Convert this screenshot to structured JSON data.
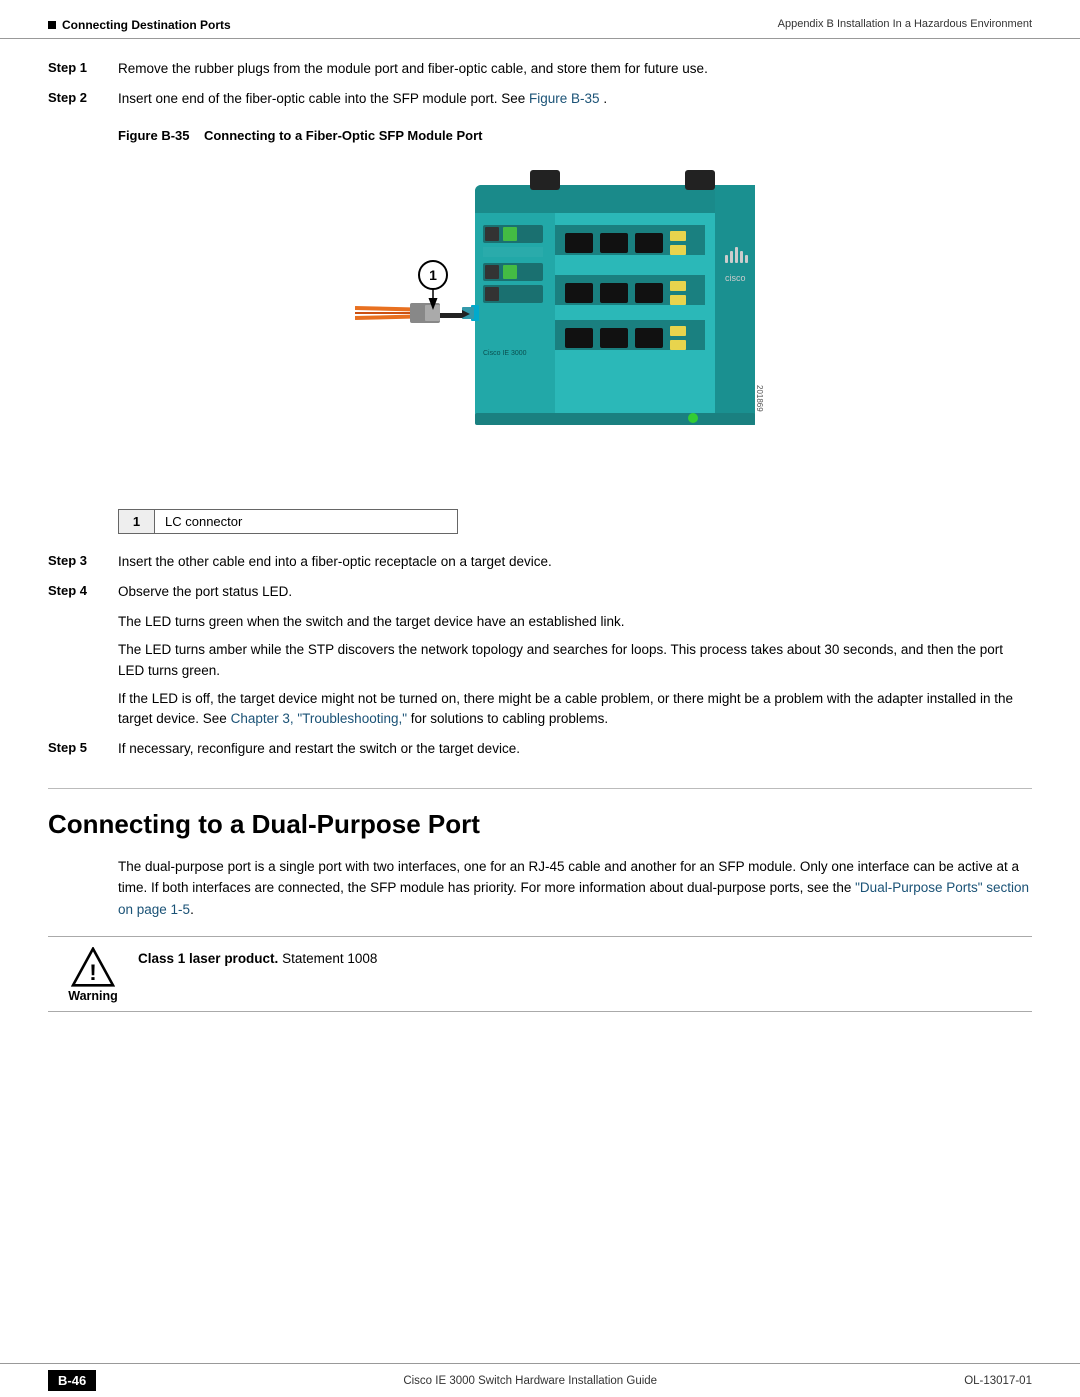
{
  "header": {
    "left_icon": "■",
    "left_text": "Connecting Destination Ports",
    "right_text": "Appendix B    Installation In a Hazardous Environment"
  },
  "steps": [
    {
      "label": "Step 1",
      "text": "Remove the rubber plugs from the module port and fiber-optic cable, and store them for future use."
    },
    {
      "label": "Step 2",
      "text": "Insert one end of the fiber-optic cable into the SFP module port. See ",
      "link": "Figure B-35",
      "text_after": "."
    }
  ],
  "figure": {
    "number": "Figure B-35",
    "caption": "Connecting to a Fiber-Optic SFP Module Port",
    "callout": {
      "number": "1",
      "label": "LC connector"
    },
    "image_id": "201869"
  },
  "steps_continued": [
    {
      "label": "Step 3",
      "text": "Insert the other cable end into a fiber-optic receptacle on a target device."
    },
    {
      "label": "Step 4",
      "text": "Observe the port status LED."
    }
  ],
  "step4_paras": [
    "The LED turns green when the switch and the target device have an established link.",
    "The LED turns amber while the STP discovers the network topology and searches for loops. This process takes about 30 seconds, and then the port LED turns green.",
    "If the LED is off, the target device might not be turned on, there might be a cable problem, or there might be a problem with the adapter installed in the target device. See "
  ],
  "step4_link": "Chapter 3, \"Troubleshooting,\"",
  "step4_link_after": " for solutions to cabling problems.",
  "step5": {
    "label": "Step 5",
    "text": "If necessary, reconfigure and restart the switch or the target device."
  },
  "dual_purpose": {
    "heading": "Connecting to a Dual-Purpose Port",
    "intro": "The dual-purpose port is a single port with two interfaces, one for an RJ-45 cable and another for an SFP module. Only one interface can be active at a time. If both interfaces are connected, the SFP module has priority. For more information about dual-purpose ports, see the ",
    "link_text": "\"Dual-Purpose Ports\" section on page 1-5",
    "intro_after": "."
  },
  "warning": {
    "icon_label": "Warning",
    "bold_text": "Class 1 laser product.",
    "normal_text": " Statement 1008"
  },
  "footer": {
    "badge": "B-46",
    "center_text": "Cisco IE 3000 Switch Hardware Installation Guide",
    "right_text": "OL-13017-01"
  }
}
